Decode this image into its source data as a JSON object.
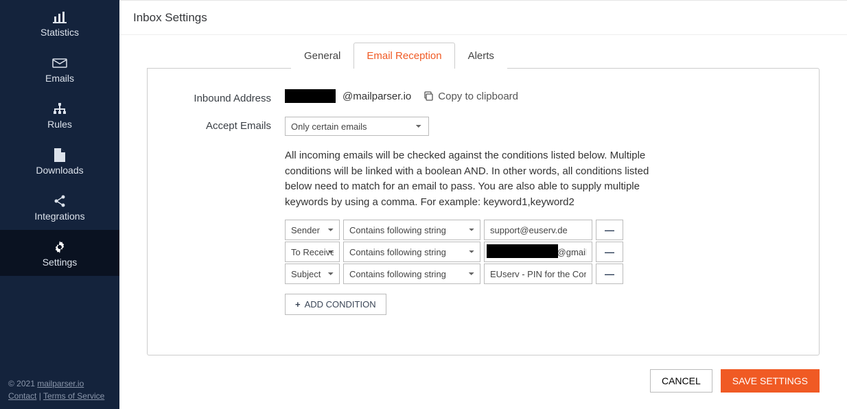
{
  "sidebar": {
    "items": [
      {
        "label": "Statistics"
      },
      {
        "label": "Emails"
      },
      {
        "label": "Rules"
      },
      {
        "label": "Downloads"
      },
      {
        "label": "Integrations"
      },
      {
        "label": "Settings"
      }
    ],
    "footer": {
      "copyright": "© 2021 ",
      "brand": "mailparser.io",
      "contact": "Contact",
      "sep": " | ",
      "terms": "Terms of Service"
    }
  },
  "page": {
    "title": "Inbox Settings"
  },
  "tabs": [
    {
      "label": "General"
    },
    {
      "label": "Email Reception"
    },
    {
      "label": "Alerts"
    }
  ],
  "form": {
    "inbound_label": "Inbound Address",
    "inbound_domain": "@mailparser.io",
    "copy_label": "Copy to clipboard",
    "accept_label": "Accept Emails",
    "accept_value": "Only certain emails",
    "help_text": "All incoming emails will be checked against the conditions listed below. Multiple conditions will be linked with a boolean AND. In other words, all conditions listed below need to match for an email to pass. You are also able to supply multiple keywords by using a comma. For example: keyword1,keyword2",
    "conditions": [
      {
        "field": "Sender",
        "op": "Contains following string",
        "value": "support@euserv.de",
        "redact": false
      },
      {
        "field": "To Receiver",
        "op": "Contains following string",
        "value": "                           @gmail",
        "redact": true
      },
      {
        "field": "Subject",
        "op": "Contains following string",
        "value": "EUserv - PIN for the Confirmation",
        "redact": false
      }
    ],
    "add_condition_label": "ADD CONDITION",
    "cancel_label": "CANCEL",
    "save_label": "SAVE SETTINGS"
  }
}
